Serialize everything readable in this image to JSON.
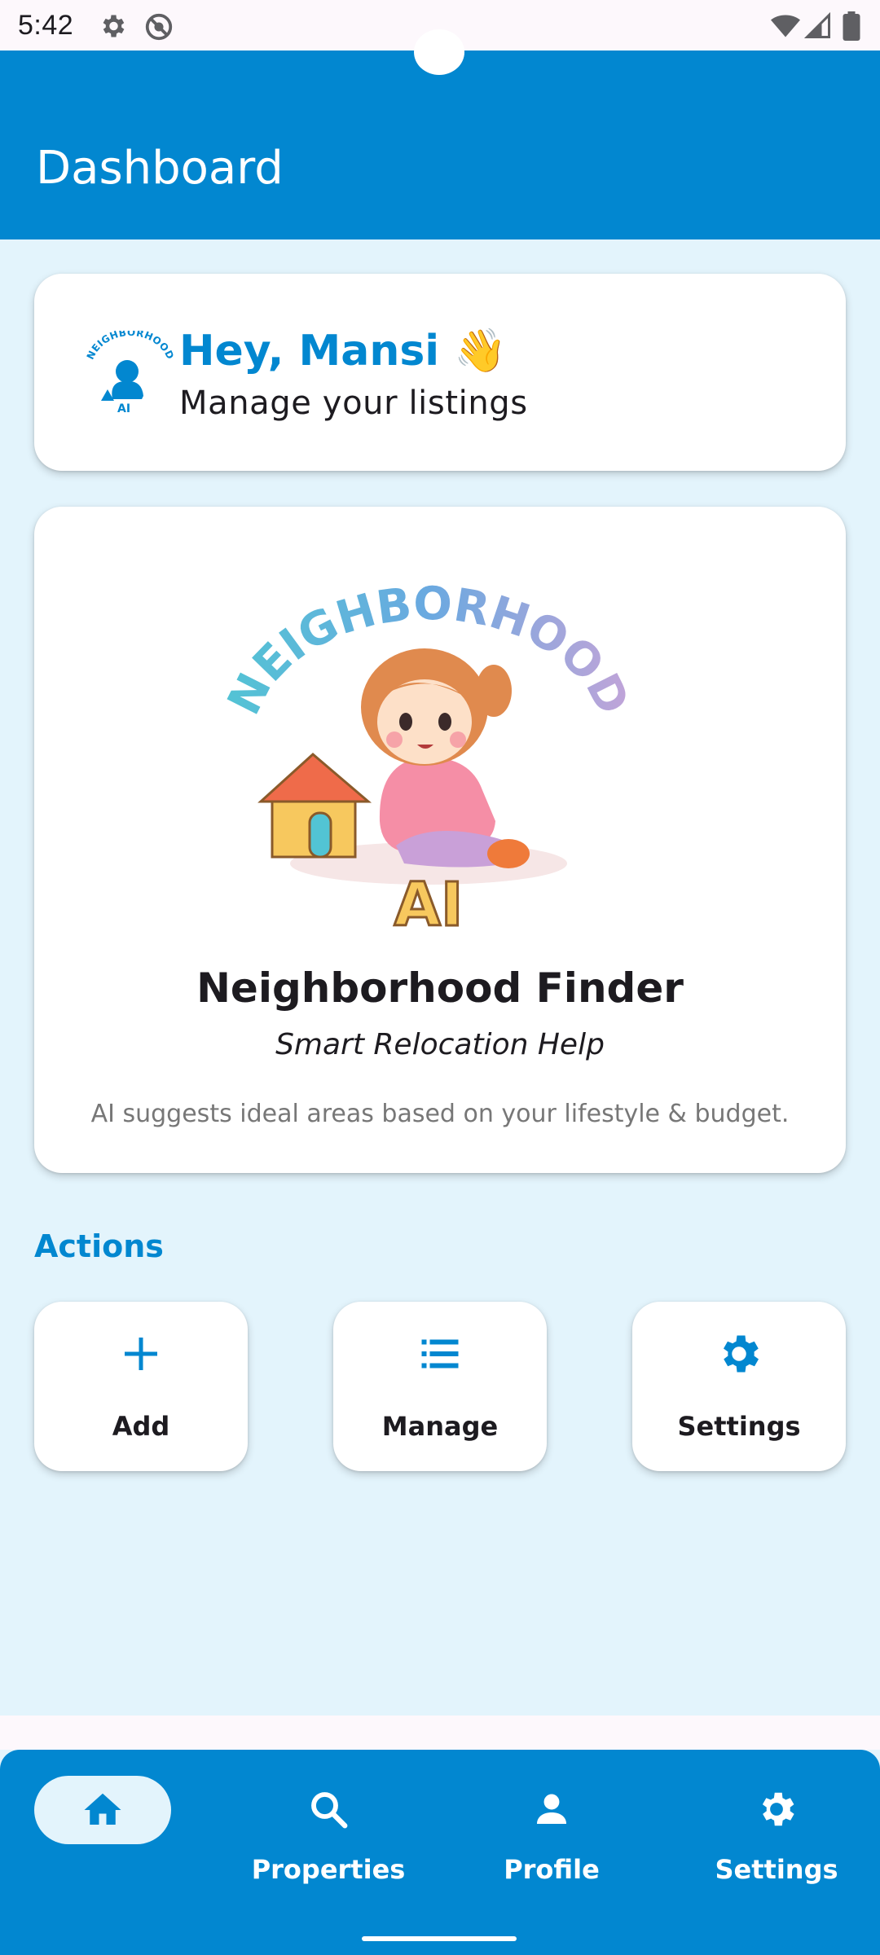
{
  "status_bar": {
    "time": "5:42",
    "left_icons": [
      "gear-icon",
      "no-data-icon"
    ],
    "right_icons": [
      "wifi-icon",
      "signal-icon",
      "battery-icon"
    ]
  },
  "app_bar": {
    "title": "Dashboard"
  },
  "greeting": {
    "title": "Hey, Mansi 👋",
    "subtitle": "Manage your listings",
    "logo_text": "NEIGHBORHOOD",
    "logo_sub": "AI"
  },
  "feature": {
    "illustration_text": "NEIGHBORHOOD",
    "illustration_sub": "AI",
    "title": "Neighborhood Finder",
    "tagline": "Smart Relocation Help",
    "description": "AI suggests ideal areas based on your lifestyle & budget."
  },
  "actions": {
    "title": "Actions",
    "items": [
      {
        "label": "Add",
        "icon": "plus-icon"
      },
      {
        "label": "Manage",
        "icon": "list-icon"
      },
      {
        "label": "Settings",
        "icon": "gear-icon"
      }
    ]
  },
  "bottom_nav": {
    "items": [
      {
        "label": "",
        "icon": "home-icon",
        "selected": true
      },
      {
        "label": "Properties",
        "icon": "search-icon",
        "selected": false
      },
      {
        "label": "Profile",
        "icon": "person-icon",
        "selected": false
      },
      {
        "label": "Settings",
        "icon": "gear-icon",
        "selected": false
      }
    ]
  },
  "colors": {
    "primary": "#0287d0",
    "background": "#e3f4fc",
    "card": "#ffffff",
    "text": "#1d1b20",
    "muted": "#777777"
  }
}
